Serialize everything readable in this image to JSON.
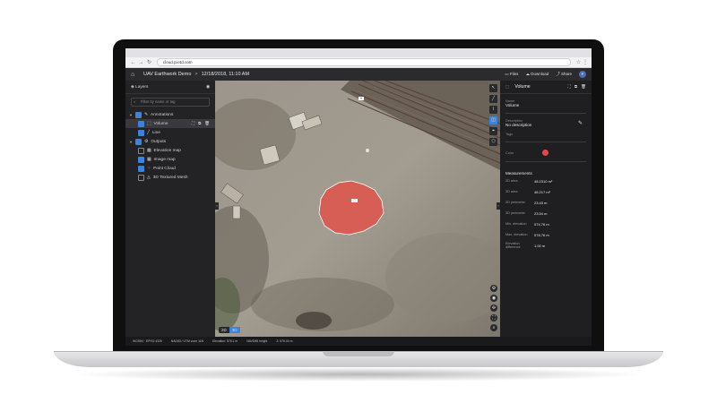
{
  "browser": {
    "url": "cloud.pix4d.com",
    "back_icon": "arrow-left-icon",
    "forward_icon": "arrow-right-icon",
    "reload_icon": "reload-icon",
    "star_icon": "star-icon",
    "menu_icon": "more-vertical-icon"
  },
  "header": {
    "project_title": "UAV Earthwork Demo",
    "separator": ">",
    "date": "12/18/2018, 11:10 AM",
    "files_label": "Files",
    "download_label": "Download",
    "share_label": "Share",
    "avatar_initial": "P"
  },
  "layers": {
    "title": "Layers",
    "filter_placeholder": "Filter by name or tag",
    "groups": [
      {
        "label": "Annotations",
        "checked": true,
        "items": [
          {
            "label": "Volume",
            "checked": true,
            "selected": true
          },
          {
            "label": "Line",
            "checked": true,
            "selected": false
          }
        ]
      },
      {
        "label": "Outputs",
        "checked": true,
        "items": [
          {
            "label": "Elevation map",
            "checked": false
          },
          {
            "label": "Image map",
            "checked": true
          },
          {
            "label": "Point Cloud",
            "checked": true
          },
          {
            "label": "3D Textured Mesh",
            "checked": false
          }
        ]
      }
    ]
  },
  "map": {
    "mode_2d": "2D",
    "mode_3d": "3D"
  },
  "properties": {
    "title": "Volume",
    "name_label": "Name",
    "name_value": "Volume",
    "description_label": "Description",
    "description_value": "No description",
    "tags_label": "Tags",
    "color_label": "Color",
    "color_value": "#e8474a",
    "measurements_title": "Measurements",
    "measurements": [
      {
        "label": "2D area",
        "value": "48.2310 m²"
      },
      {
        "label": "3D area",
        "value": "48.217 m²"
      },
      {
        "label": "2D perimeter",
        "value": "23.43 m"
      },
      {
        "label": "3D perimeter",
        "value": "23.54 m"
      },
      {
        "label": "Min. elevation",
        "value": "574.76 m"
      },
      {
        "label": "Max. elevation",
        "value": "578.76 m"
      },
      {
        "label": "Elevation difference",
        "value": "1.00 m"
      }
    ]
  },
  "status_bar": {
    "items": [
      "WGS84 · EPSG:4326",
      "NAD83 / UTM zone 11N",
      "Elevation: 575.1 m",
      "NAVD88 height",
      "Z: 576.04 m"
    ]
  }
}
